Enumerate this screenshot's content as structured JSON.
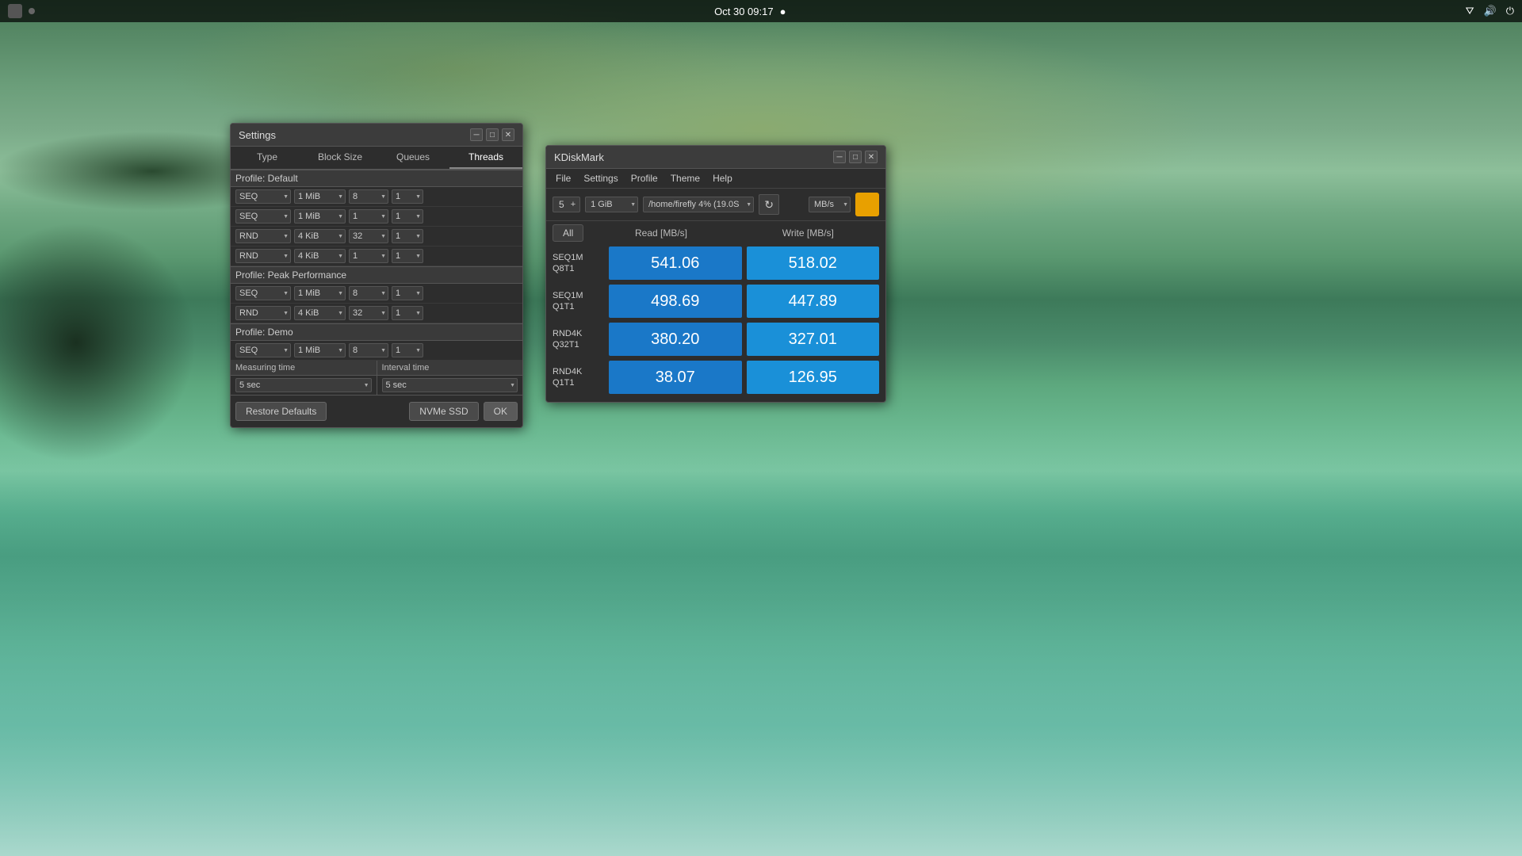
{
  "taskbar": {
    "datetime": "Oct 30  09:17",
    "app_icon": "●"
  },
  "settings_window": {
    "title": "Settings",
    "tabs": [
      "Type",
      "Block Size",
      "Queues",
      "Threads"
    ],
    "profiles": [
      {
        "name": "Profile: Default",
        "rows": [
          {
            "type": "SEQ",
            "block_size": "1 MiB",
            "queues": "8",
            "threads": "1"
          },
          {
            "type": "SEQ",
            "block_size": "1 MiB",
            "queues": "1",
            "threads": "1"
          },
          {
            "type": "RND",
            "block_size": "4 KiB",
            "queues": "32",
            "threads": "1"
          },
          {
            "type": "RND",
            "block_size": "4 KiB",
            "queues": "1",
            "threads": "1"
          }
        ]
      },
      {
        "name": "Profile: Peak Performance",
        "rows": [
          {
            "type": "SEQ",
            "block_size": "1 MiB",
            "queues": "8",
            "threads": "1"
          },
          {
            "type": "RND",
            "block_size": "4 KiB",
            "queues": "32",
            "threads": "1"
          }
        ]
      },
      {
        "name": "Profile: Demo",
        "rows": [
          {
            "type": "SEQ",
            "block_size": "1 MiB",
            "queues": "8",
            "threads": "1"
          }
        ]
      }
    ],
    "measuring_time_label": "Measuring time",
    "interval_time_label": "Interval time",
    "measuring_time_value": "5 sec",
    "interval_time_value": "5 sec",
    "buttons": {
      "restore_defaults": "Restore Defaults",
      "nvme_ssd": "NVMe SSD",
      "ok": "OK"
    }
  },
  "kdiskmark_window": {
    "title": "KDiskMark",
    "menu_items": [
      "File",
      "Settings",
      "Profile",
      "Theme",
      "Help"
    ],
    "runs": "5",
    "size": "1 GiB",
    "path": "/home/firefly 4% (19.0S",
    "unit": "MB/s",
    "all_btn": "All",
    "col_headers": [
      "Read [MB/s]",
      "Write [MB/s]"
    ],
    "results": [
      {
        "label": "SEQ1M\nQ8T1",
        "label_line1": "SEQ1M",
        "label_line2": "Q8T1",
        "read": "541.06",
        "write": "518.02"
      },
      {
        "label": "SEQ1M\nQ1T1",
        "label_line1": "SEQ1M",
        "label_line2": "Q1T1",
        "read": "498.69",
        "write": "447.89"
      },
      {
        "label": "RND4K\nQ32T1",
        "label_line1": "RND4K",
        "label_line2": "Q32T1",
        "read": "380.20",
        "write": "327.01"
      },
      {
        "label": "RND4K\nQ1T1",
        "label_line1": "RND4K",
        "label_line2": "Q1T1",
        "read": "38.07",
        "write": "126.95"
      }
    ]
  }
}
